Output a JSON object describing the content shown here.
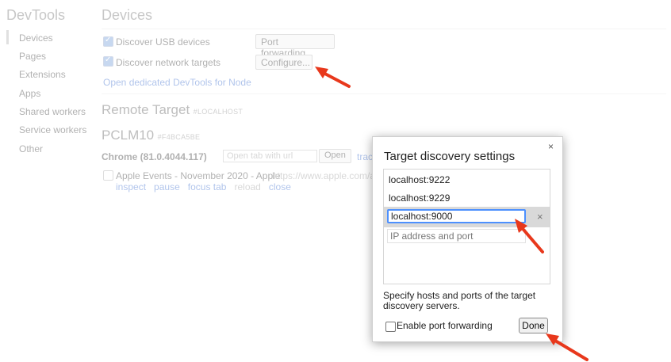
{
  "app": {
    "title": "DevTools"
  },
  "sidebar": {
    "items": [
      {
        "label": "Devices"
      },
      {
        "label": "Pages"
      },
      {
        "label": "Extensions"
      },
      {
        "label": "Apps"
      },
      {
        "label": "Shared workers"
      },
      {
        "label": "Service workers"
      },
      {
        "label": "Other"
      }
    ]
  },
  "main": {
    "title": "Devices",
    "discover_usb_label": "Discover USB devices",
    "port_forwarding_button": "Port forwarding...",
    "discover_network_label": "Discover network targets",
    "configure_button": "Configure...",
    "open_node_link": "Open dedicated DevTools for Node",
    "remote_target_heading": "Remote Target",
    "remote_target_tag": "#LOCALHOST",
    "device_name": "PCLM10",
    "device_tag": "#F4BCA5BE",
    "browser_label": "Chrome (81.0.4044.117)",
    "open_tab_placeholder": "Open tab with url",
    "open_button": "Open",
    "trace_link": "trac",
    "tab_title": "Apple Events - November 2020 - Apple",
    "tab_url": "https://www.apple.com/a",
    "actions": {
      "inspect": "inspect",
      "pause": "pause",
      "focus_tab": "focus tab",
      "reload": "reload",
      "close": "close"
    }
  },
  "dialog": {
    "title": "Target discovery settings",
    "close_glyph": "×",
    "hosts": [
      "localhost:9222",
      "localhost:9229"
    ],
    "editing_value": "localhost:9000",
    "remove_glyph": "×",
    "new_placeholder": "IP address and port",
    "help_text": "Specify hosts and ports of the target discovery servers.",
    "enable_port_forwarding_label": "Enable port forwarding",
    "done_button": "Done"
  },
  "colors": {
    "link": "#3366cc",
    "focus_ring": "#4d90fe",
    "annotation_arrow": "#e8381c"
  }
}
